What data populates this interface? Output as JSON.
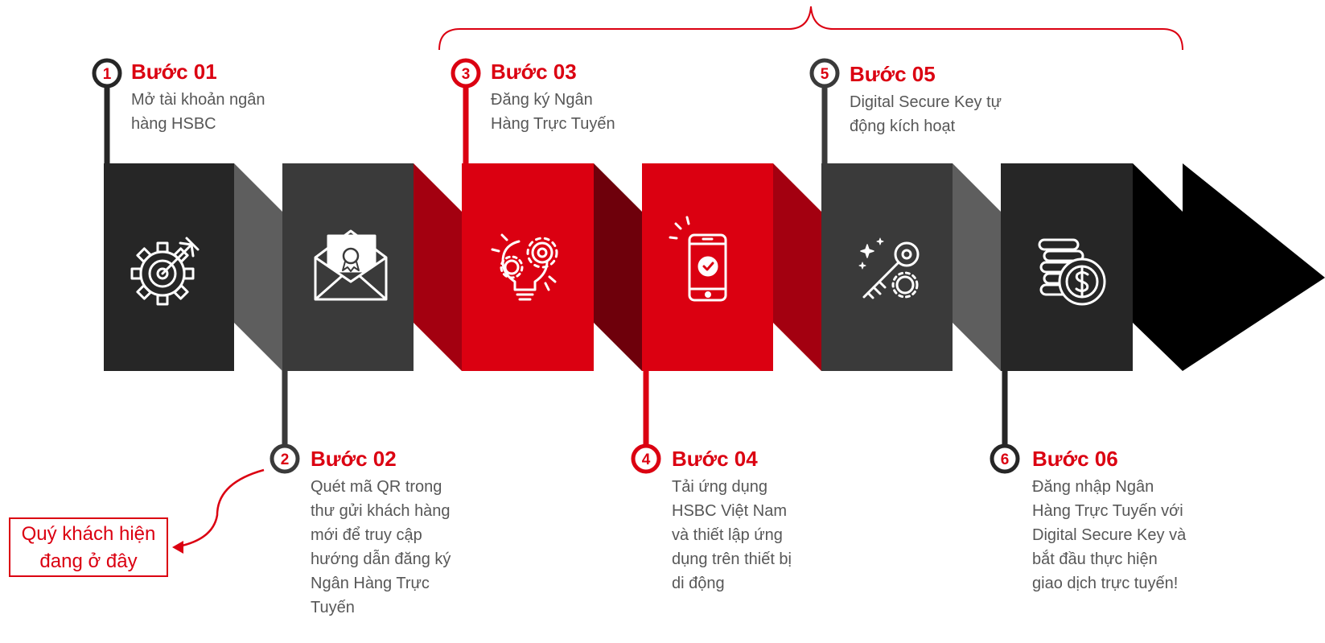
{
  "colors": {
    "red": "#db0011",
    "dark_red": "#a30010",
    "darker_red": "#6e000b",
    "black_panel": "#262626",
    "dark_panel": "#3a3a3a",
    "gray_fold": "#5e5e5e",
    "arrow": "#000000",
    "text_gray": "#575757"
  },
  "steps": [
    {
      "number": "1",
      "title": "Bước 01",
      "desc": [
        "Mở tài khoản ngân",
        "hàng HSBC"
      ],
      "icon": "gear-target-icon"
    },
    {
      "number": "2",
      "title": "Bước 02",
      "desc": [
        "Quét mã QR trong",
        "thư gửi khách hàng",
        "mới để truy cập",
        "hướng dẫn đăng ký",
        "Ngân Hàng Trực",
        "Tuyến"
      ],
      "icon": "envelope-badge-icon"
    },
    {
      "number": "3",
      "title": "Bước 03",
      "desc": [
        "Đăng ký Ngân",
        "Hàng Trực Tuyến"
      ],
      "icon": "lightbulb-gears-icon"
    },
    {
      "number": "4",
      "title": "Bước 04",
      "desc": [
        "Tải ứng dụng",
        "HSBC Việt Nam",
        "và thiết lập ứng",
        "dụng trên thiết bị",
        "di động"
      ],
      "icon": "smartphone-check-icon"
    },
    {
      "number": "5",
      "title": "Bước 05",
      "desc": [
        "Digital Secure Key tự",
        "động kích hoạt"
      ],
      "icon": "key-gear-icon"
    },
    {
      "number": "6",
      "title": "Bước 06",
      "desc": [
        "Đăng nhập Ngân",
        "Hàng Trực Tuyến với",
        "Digital Secure Key và",
        "bắt đầu thực hiện",
        "giao dịch trực tuyến!"
      ],
      "icon": "coins-dollar-icon"
    }
  ],
  "you_are_here": [
    "Quý khách hiện",
    "đang ở đây"
  ]
}
